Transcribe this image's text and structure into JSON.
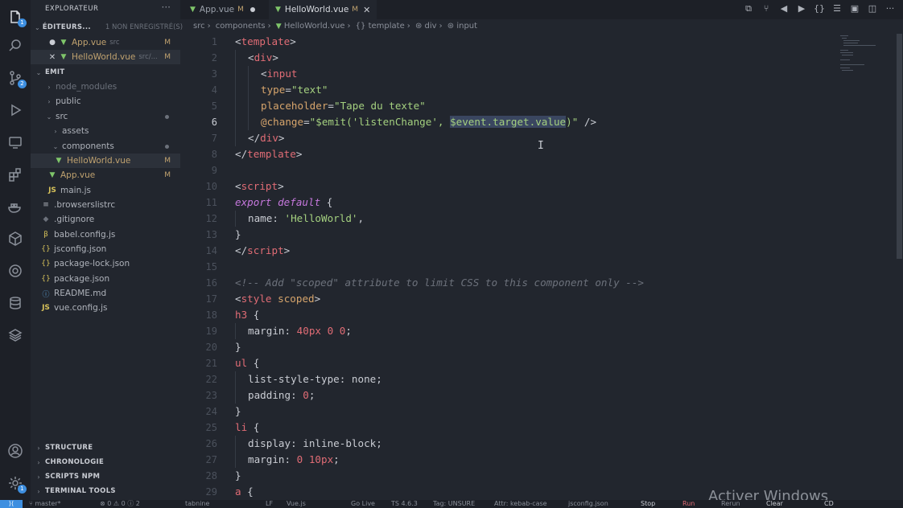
{
  "activity": {
    "explorer_badge": "1",
    "scm_badge": "2",
    "settings_badge": "1"
  },
  "sidebar": {
    "title": "EXPLORATEUR",
    "more": "···",
    "open_editors": {
      "label": "ÉDITEURS...",
      "hint": "1 NON ENREGISTRÉ(S)",
      "items": [
        {
          "prefix": "●",
          "name": "App.vue",
          "hint": "src",
          "status": "M"
        },
        {
          "prefix": "✕",
          "name": "HelloWorld.vue",
          "hint": "src/...",
          "status": "M"
        }
      ]
    },
    "root_label": "EMIT",
    "tree": {
      "node_modules": "node_modules",
      "public": "public",
      "src": "src",
      "assets": "assets",
      "components": "components",
      "helloworld": "HelloWorld.vue",
      "helloworld_status": "M",
      "appvue": "App.vue",
      "appvue_status": "M",
      "mainjs": "main.js",
      "browserslistrc": ".browserslistrc",
      "gitignore": ".gitignore",
      "babel": "babel.config.js",
      "jsconfig": "jsconfig.json",
      "packagelock": "package-lock.json",
      "package": "package.json",
      "readme": "README.md",
      "vueconfig": "vue.config.js"
    },
    "sections": {
      "structure": "STRUCTURE",
      "timeline": "CHRONOLOGIE",
      "npm": "SCRIPTS NPM",
      "terminal": "TERMINAL TOOLS"
    }
  },
  "tabs": [
    {
      "label": "App.vue",
      "mod": "M"
    },
    {
      "label": "HelloWorld.vue",
      "mod": "M"
    }
  ],
  "breadcrumb": {
    "p1": "src",
    "p2": "components",
    "p3": "HelloWorld.vue",
    "p4": "template",
    "p5": "div",
    "p6": "input"
  },
  "editor": {
    "current_line": 6,
    "t": {
      "template": "template",
      "div": "div",
      "input": "input",
      "type_attr": "type",
      "type_val": "\"text\"",
      "ph_attr": "placeholder",
      "ph_val": "\"Tape du texte\"",
      "change_attr": "@change",
      "change_a": "\"$emit('listenChange', ",
      "change_sel": "$event.target.value",
      "change_b": ")\"",
      "close_self": " />",
      "script": "script",
      "export": "export default",
      "brace_open": " {",
      "name_key": "name",
      "name_val": "'HelloWorld'",
      "comment": "<!-- Add \"scoped\" attribute to limit CSS to this component only -->",
      "style": "style",
      "scoped": "scoped",
      "h3": "h3",
      "margin": "margin",
      "m1": "40px 0 0",
      "ul": "ul",
      "lst": "list-style-type",
      "none": "none",
      "padding": "padding",
      "zero": "0",
      "li": "li",
      "display": "display",
      "inline": "inline-block",
      "m2": "0 10px",
      "a": "a"
    }
  },
  "watermark": "Activer Windows",
  "status": {
    "branch": "master*",
    "problems": "⊗ 0 ⚠ 0 ⓘ 2",
    "tabnine": "tabnine",
    "eol": "LF",
    "lang": "Vue.js",
    "golive": "Go Live",
    "ts": "TS 4.6.3",
    "tag": "Tag: UNSURE",
    "attr": "Attr: kebab-case",
    "jsconfig": "jsconfig.json",
    "stop": "Stop",
    "run": "Run",
    "rerun": "Rerun",
    "clear": "Clear",
    "cd": "CD"
  }
}
